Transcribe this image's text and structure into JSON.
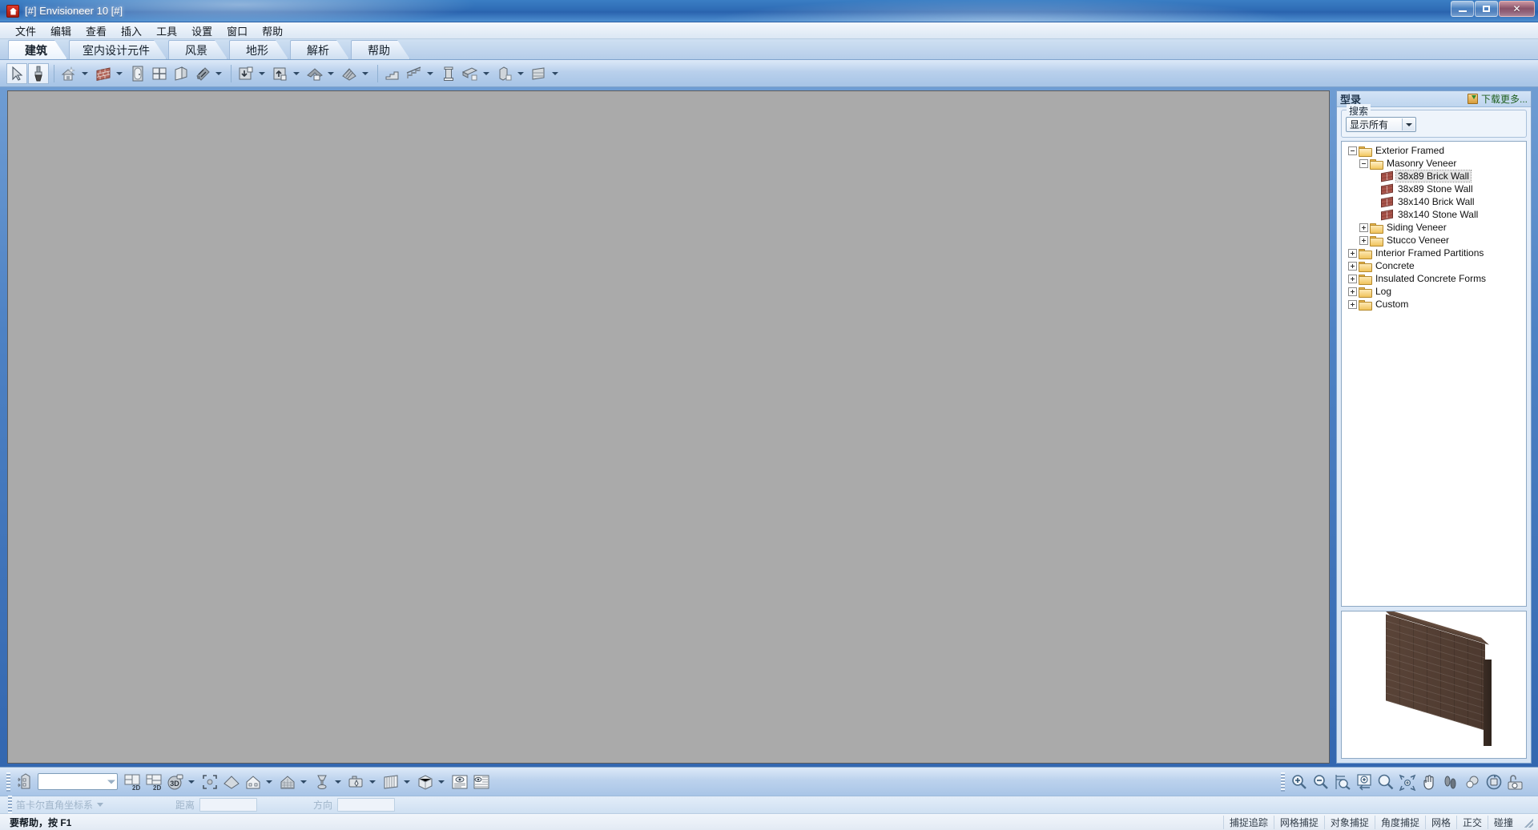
{
  "window": {
    "title": "[#] Envisioneer 10 [#]",
    "app_icon": "envisioneer-house-icon",
    "buttons": {
      "minimize": "minimize-icon",
      "restore": "restore-icon",
      "close": "close-icon"
    }
  },
  "menubar": {
    "items": [
      {
        "label": "文件",
        "name": "menu-file"
      },
      {
        "label": "编辑",
        "name": "menu-edit"
      },
      {
        "label": "查看",
        "name": "menu-view"
      },
      {
        "label": "插入",
        "name": "menu-insert"
      },
      {
        "label": "工具",
        "name": "menu-tools"
      },
      {
        "label": "设置",
        "name": "menu-settings"
      },
      {
        "label": "窗口",
        "name": "menu-window"
      },
      {
        "label": "帮助",
        "name": "menu-help"
      }
    ]
  },
  "tabs": [
    {
      "label": "建筑",
      "active": true
    },
    {
      "label": "室内设计元件",
      "active": false
    },
    {
      "label": "风景",
      "active": false
    },
    {
      "label": "地形",
      "active": false
    },
    {
      "label": "解析",
      "active": false
    },
    {
      "label": "帮助",
      "active": false
    }
  ],
  "main_toolbar": {
    "buttons": [
      {
        "name": "select-arrow-icon",
        "dropdown": false,
        "pressed": true
      },
      {
        "name": "paintbrush-icon",
        "dropdown": false,
        "pressed": true
      },
      {
        "name": "house-wizard-icon",
        "dropdown": true
      },
      {
        "name": "wall-icon",
        "dropdown": true
      },
      {
        "name": "door-icon",
        "dropdown": false
      },
      {
        "name": "window-icon",
        "dropdown": false
      },
      {
        "name": "opening-icon",
        "dropdown": false
      },
      {
        "name": "material-region-icon",
        "dropdown": true
      },
      {
        "name": "floor-down-icon",
        "dropdown": true
      },
      {
        "name": "floor-up-icon",
        "dropdown": true
      },
      {
        "name": "roof-icon",
        "dropdown": true
      },
      {
        "name": "roof-plane-icon",
        "dropdown": true
      },
      {
        "name": "stairs-icon",
        "dropdown": false
      },
      {
        "name": "railing-icon",
        "dropdown": true
      },
      {
        "name": "column-icon",
        "dropdown": false
      },
      {
        "name": "beam-icon",
        "dropdown": true
      },
      {
        "name": "post-icon",
        "dropdown": true
      },
      {
        "name": "deck-icon",
        "dropdown": true
      }
    ]
  },
  "bottom_toolbar": {
    "level_combo_value": "",
    "buttons": [
      {
        "name": "building-levels-icon",
        "dropdown": false
      },
      {
        "name": "view-2d-icon",
        "dropdown": false
      },
      {
        "name": "view-2d-plus-icon",
        "dropdown": false
      },
      {
        "name": "view-3d-icon",
        "dropdown": true
      },
      {
        "name": "zoom-fit-icon",
        "dropdown": false
      },
      {
        "name": "roof-view-icon",
        "dropdown": false
      },
      {
        "name": "elevation-view-icon",
        "dropdown": true
      },
      {
        "name": "section-view-icon",
        "dropdown": true
      },
      {
        "name": "render-quality-icon",
        "dropdown": true
      },
      {
        "name": "camera-view-icon",
        "dropdown": true
      },
      {
        "name": "fence-view-icon",
        "dropdown": true
      },
      {
        "name": "perspective-box-icon",
        "dropdown": true
      },
      {
        "name": "report-preview-icon",
        "dropdown": false
      },
      {
        "name": "report-list-icon",
        "dropdown": false
      }
    ],
    "right_buttons": [
      {
        "name": "zoom-in-icon"
      },
      {
        "name": "zoom-out-icon"
      },
      {
        "name": "zoom-window-icon"
      },
      {
        "name": "zoom-previous-icon"
      },
      {
        "name": "zoom-extents-icon"
      },
      {
        "name": "zoom-all-icon"
      },
      {
        "name": "pan-hand-icon"
      },
      {
        "name": "walk-through-icon"
      },
      {
        "name": "orbit-icon"
      },
      {
        "name": "rotate-view-icon"
      },
      {
        "name": "snapshot-camera-icon"
      }
    ]
  },
  "catalog_panel": {
    "title": "型录",
    "download_more": "下载更多...",
    "download_icon": "download-box-icon",
    "search_legend": "搜索",
    "filter_value": "显示所有",
    "tree": [
      {
        "label": "Exterior Framed",
        "depth": 0,
        "icon": "folder-open-icon",
        "expander": "minus",
        "selected": false
      },
      {
        "label": "Masonry Veneer",
        "depth": 1,
        "icon": "folder-open-icon",
        "expander": "minus",
        "selected": false
      },
      {
        "label": "38x89  Brick Wall",
        "depth": 2,
        "icon": "brick-wall-icon",
        "expander": "none",
        "selected": true
      },
      {
        "label": "38x89 Stone Wall",
        "depth": 2,
        "icon": "brick-wall-icon",
        "expander": "none",
        "selected": false
      },
      {
        "label": "38x140 Brick Wall",
        "depth": 2,
        "icon": "brick-wall-icon",
        "expander": "none",
        "selected": false
      },
      {
        "label": "38x140 Stone Wall",
        "depth": 2,
        "icon": "brick-wall-icon",
        "expander": "none",
        "selected": false
      },
      {
        "label": "Siding Veneer",
        "depth": 1,
        "icon": "folder-icon",
        "expander": "plus",
        "selected": false
      },
      {
        "label": "Stucco Veneer",
        "depth": 1,
        "icon": "folder-icon",
        "expander": "plus",
        "selected": false
      },
      {
        "label": "Interior Framed Partitions",
        "depth": 0,
        "icon": "folder-icon",
        "expander": "plus",
        "selected": false
      },
      {
        "label": "Concrete",
        "depth": 0,
        "icon": "folder-icon",
        "expander": "plus",
        "selected": false
      },
      {
        "label": "Insulated Concrete Forms",
        "depth": 0,
        "icon": "folder-icon",
        "expander": "plus",
        "selected": false
      },
      {
        "label": "Log",
        "depth": 0,
        "icon": "folder-icon",
        "expander": "plus",
        "selected": false
      },
      {
        "label": "Custom",
        "depth": 0,
        "icon": "folder-icon",
        "expander": "plus",
        "selected": false
      }
    ],
    "preview_item": "brick-wall-3d-preview"
  },
  "coordinate_bar": {
    "system_label": "笛卡尔直角坐标系",
    "distance_label": "距离",
    "distance_value": "",
    "direction_label": "方向",
    "direction_value": ""
  },
  "statusbar": {
    "message": "要帮助，按 F1",
    "panels": [
      "捕捉追踪",
      "网格捕捉",
      "对象捕捉",
      "角度捕捉",
      "网格",
      "正交",
      "碰撞"
    ]
  },
  "colors": {
    "title_blue": "#2f6cb5",
    "canvas_gray": "#aaaaaa",
    "accent_green": "#1f5f1f",
    "brick_brown": "#4b382e"
  }
}
